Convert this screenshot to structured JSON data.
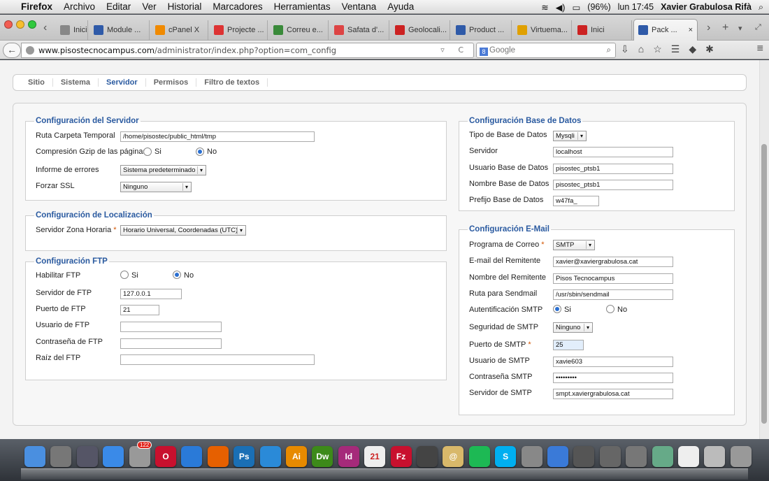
{
  "menubar": {
    "app": "Firefox",
    "items": [
      "Archivo",
      "Editar",
      "Ver",
      "Historial",
      "Marcadores",
      "Herramientas",
      "Ventana",
      "Ayuda"
    ],
    "battery": "(96%)",
    "clock": "lun 17:45",
    "user": "Xavier Grabulosa Rifà"
  },
  "tabs": [
    {
      "label": "Inici",
      "color": "#888"
    },
    {
      "label": "Module ...",
      "color": "#2f5aa8"
    },
    {
      "label": "cPanel X",
      "color": "#f08a00"
    },
    {
      "label": "Projecte ...",
      "color": "#d33"
    },
    {
      "label": "Correu e...",
      "color": "#3a8a3a"
    },
    {
      "label": "Safata d'...",
      "color": "#d44"
    },
    {
      "label": "Geolocali...",
      "color": "#c22"
    },
    {
      "label": "Product ...",
      "color": "#2f5aa8"
    },
    {
      "label": "Virtuema...",
      "color": "#e0a000"
    },
    {
      "label": "Inici",
      "color": "#c22"
    },
    {
      "label": "Pack ...",
      "color": "#2f5aa8"
    }
  ],
  "nav": {
    "url_host": "www.pisostecnocampus.com",
    "url_path": "/administrator/index.php?option=com_config",
    "search_placeholder": "Google"
  },
  "subtabs": [
    "Sitio",
    "Sistema",
    "Servidor",
    "Permisos",
    "Filtro de textos"
  ],
  "server": {
    "legend": "Configuración del Servidor",
    "temp_label": "Ruta Carpeta Temporal",
    "temp_value": "/home/pisostec/public_html/tmp",
    "gzip_label": "Compresión Gzip de las páginas",
    "yes": "Si",
    "no": "No",
    "errors_label": "Informe de errores",
    "errors_value": "Sistema predeterminado",
    "ssl_label": "Forzar SSL",
    "ssl_value": "Ninguno"
  },
  "locale": {
    "legend": "Configuración de Localización",
    "tz_label": "Servidor Zona Horaria",
    "tz_value": "Horario Universal, Coordenadas (UTC)"
  },
  "ftp": {
    "legend": "Configuración FTP",
    "enable_label": "Habilitar FTP",
    "yes": "Si",
    "no": "No",
    "server_label": "Servidor de FTP",
    "server_value": "127.0.0.1",
    "port_label": "Puerto de FTP",
    "port_value": "21",
    "user_label": "Usuario de FTP",
    "user_value": "",
    "pass_label": "Contraseña de FTP",
    "pass_value": "",
    "root_label": "Raíz del FTP",
    "root_value": ""
  },
  "db": {
    "legend": "Configuración Base de Datos",
    "type_label": "Tipo de Base de Datos",
    "type_value": "Mysqli",
    "server_label": "Servidor",
    "server_value": "localhost",
    "user_label": "Usuario Base de Datos",
    "user_value": "pisostec_ptsb1",
    "name_label": "Nombre Base de Datos",
    "name_value": "pisostec_ptsb1",
    "prefix_label": "Prefijo Base de Datos",
    "prefix_value": "w47fa_"
  },
  "mail": {
    "legend": "Configuración E-Mail",
    "mailer_label": "Programa de Correo",
    "mailer_value": "SMTP",
    "from_label": "E-mail del Remitente",
    "from_value": "xavier@xaviergrabulosa.cat",
    "fromname_label": "Nombre del Remitente",
    "fromname_value": "Pisos Tecnocampus",
    "sendmail_label": "Ruta para Sendmail",
    "sendmail_value": "/usr/sbin/sendmail",
    "auth_label": "Autentificación SMTP",
    "yes": "Si",
    "no": "No",
    "secure_label": "Seguridad de SMTP",
    "secure_value": "Ninguno",
    "port_label": "Puerto de SMTP",
    "port_value": "25",
    "user_label": "Usuario de SMTP",
    "user_value": "xavie603",
    "pass_label": "Contraseña SMTP",
    "pass_value": "•••••••••",
    "host_label": "Servidor de SMTP",
    "host_value": "smpt.xaviergrabulosa.cat"
  },
  "dock": [
    {
      "name": "finder",
      "color": "#4a8fe0",
      "glyph": ""
    },
    {
      "name": "launchpad",
      "color": "#777",
      "glyph": ""
    },
    {
      "name": "mission-control",
      "color": "#556",
      "glyph": ""
    },
    {
      "name": "app-store",
      "color": "#3a8ae8",
      "glyph": ""
    },
    {
      "name": "contacts",
      "color": "#999",
      "glyph": ""
    },
    {
      "name": "opera",
      "color": "#c8102e",
      "glyph": "O"
    },
    {
      "name": "safari",
      "color": "#2a7ad8",
      "glyph": ""
    },
    {
      "name": "firefox",
      "color": "#e66000",
      "glyph": ""
    },
    {
      "name": "photoshop",
      "color": "#1a6fb5",
      "glyph": "Ps"
    },
    {
      "name": "dropbox",
      "color": "#2a8ad8",
      "glyph": ""
    },
    {
      "name": "illustrator",
      "color": "#e78a00",
      "glyph": "Ai"
    },
    {
      "name": "dreamweaver",
      "color": "#3d8a1a",
      "glyph": "Dw"
    },
    {
      "name": "indesign",
      "color": "#a52a7a",
      "glyph": "Id"
    },
    {
      "name": "calendar",
      "color": "#eee",
      "glyph": "21"
    },
    {
      "name": "filezilla",
      "color": "#c8102e",
      "glyph": "Fz"
    },
    {
      "name": "facetime",
      "color": "#444",
      "glyph": ""
    },
    {
      "name": "mail",
      "color": "#d8b86a",
      "glyph": "@"
    },
    {
      "name": "spotify",
      "color": "#1db954",
      "glyph": ""
    },
    {
      "name": "skype",
      "color": "#00aff0",
      "glyph": "S"
    },
    {
      "name": "preferences",
      "color": "#888",
      "glyph": ""
    },
    {
      "name": "itunes",
      "color": "#3a7ad8",
      "glyph": ""
    },
    {
      "name": "preview",
      "color": "#555",
      "glyph": ""
    },
    {
      "name": "network",
      "color": "#666",
      "glyph": ""
    },
    {
      "name": "utilities",
      "color": "#777",
      "glyph": ""
    },
    {
      "name": "iphoto",
      "color": "#6a8",
      "glyph": ""
    },
    {
      "name": "chrome",
      "color": "#eee",
      "glyph": ""
    },
    {
      "name": "downloads",
      "color": "#bbb",
      "glyph": ""
    },
    {
      "name": "trash",
      "color": "#999",
      "glyph": ""
    }
  ],
  "badges": {
    "contacts": "122"
  }
}
